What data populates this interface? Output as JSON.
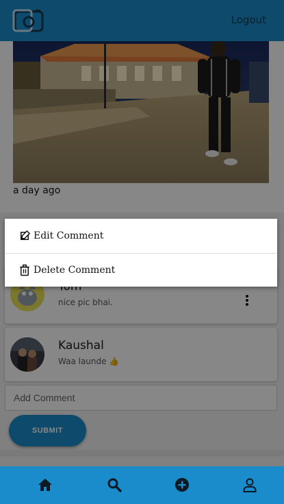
{
  "header": {
    "logout_label": "Logout",
    "logo_icon": "camera-logo-icon"
  },
  "post": {
    "time_ago": "a day ago"
  },
  "comments": [
    {
      "name": "Tom",
      "text": "nice pic bhai.",
      "avatar_icon": "avatar-icon"
    },
    {
      "name": "Kaushal",
      "text": "Waa launde 👍",
      "avatar_icon": "avatar-icon"
    }
  ],
  "add_comment": {
    "placeholder": "Add Comment",
    "submit_label": "SUBMIT"
  },
  "context_menu": {
    "edit_label": "Edit Comment",
    "delete_label": "Delete Comment",
    "edit_icon": "edit-icon",
    "delete_icon": "trash-icon"
  },
  "bottom_nav": [
    "home-icon",
    "search-icon",
    "add-icon",
    "profile-icon"
  ],
  "colors": {
    "primary": "#1a8ccc",
    "dark_text": "#163a52"
  }
}
